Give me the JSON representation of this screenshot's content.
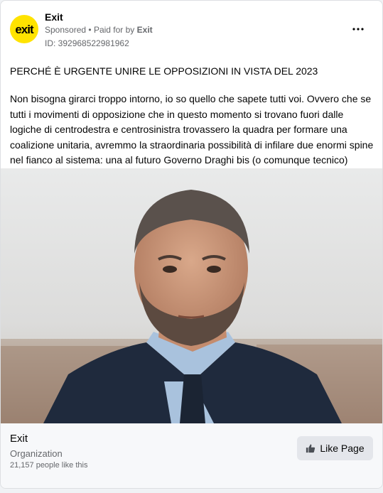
{
  "header": {
    "page_name": "Exit",
    "sponsored": "Sponsored",
    "separator": "•",
    "paid_for_prefix": "Paid for by",
    "paid_for_name": "Exit",
    "ad_id": "ID: 392968522981962",
    "logo_text": "exit",
    "more_icon": "more-horizontal-icon"
  },
  "post": {
    "headline": "PERCHÉ È URGENTE UNIRE LE OPPOSIZIONI IN VISTA DEL 2023",
    "body": "Non bisogna girarci troppo intorno, io so quello che sapete tutti voi. Ovvero che se tutti i movimenti di opposizione che in questo momento si trovano fuori dalle logiche di centrodestra e centrosinistra trovassero la quadra per formare una coalizione unitaria, avremmo la straordinaria possibilità di infilare due enormi spine nel fianco al sistema: una al futuro Governo Draghi bis (o comunque tecnico) che…"
  },
  "footer": {
    "name": "Exit",
    "category": "Organization",
    "likes": "21,157 people like this",
    "like_button": "Like Page"
  },
  "colors": {
    "brand_yellow": "#ffe300",
    "text_primary": "#050505",
    "text_secondary": "#65676b"
  }
}
